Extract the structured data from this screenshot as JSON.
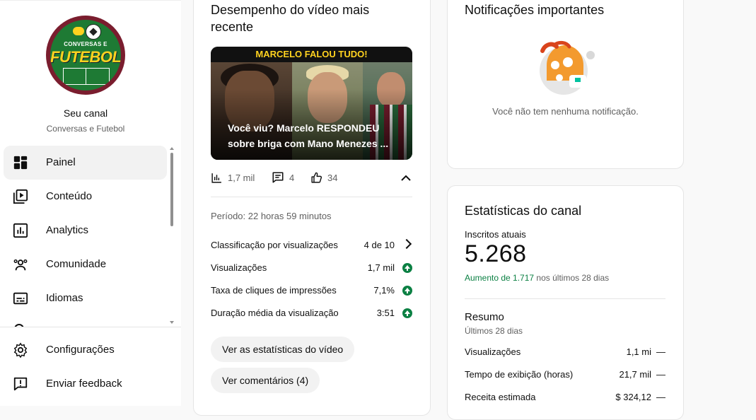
{
  "sidebar": {
    "logo": {
      "top_text": "CONVERSAS E",
      "big_text": "FUTEBOL"
    },
    "channel_label": "Seu canal",
    "channel_name": "Conversas e Futebol",
    "items": [
      {
        "label": "Painel",
        "icon": "dashboard-icon",
        "active": true
      },
      {
        "label": "Conteúdo",
        "icon": "content-icon"
      },
      {
        "label": "Analytics",
        "icon": "analytics-icon"
      },
      {
        "label": "Comunidade",
        "icon": "community-icon"
      },
      {
        "label": "Idiomas",
        "icon": "subtitles-icon"
      }
    ],
    "bottom_items": [
      {
        "label": "Configurações",
        "icon": "gear-icon"
      },
      {
        "label": "Enviar feedback",
        "icon": "feedback-icon"
      }
    ]
  },
  "latest_video": {
    "title": "Desempenho do vídeo mais recente",
    "thumbnail_banner": "MARCELO FALOU TUDO!",
    "video_title": "Você viu? Marcelo RESPONDEU sobre briga com Mano Menezes ...",
    "views": "1,7 mil",
    "comments": "4",
    "likes": "34",
    "period": "Período: 22 horas 59 minutos",
    "metrics": [
      {
        "label": "Classificação por visualizações",
        "value": "4 de 10"
      },
      {
        "label": "Visualizações",
        "value": "1,7 mil"
      },
      {
        "label": "Taxa de cliques de impressões",
        "value": "7,1%"
      },
      {
        "label": "Duração média da visualização",
        "value": "3:51"
      }
    ],
    "btn_stats": "Ver as estatísticas do vídeo",
    "btn_comments": "Ver comentários (4)"
  },
  "notifications": {
    "title": "Notificações importantes",
    "empty_text": "Você não tem nenhuma notificação."
  },
  "channel_stats": {
    "title": "Estatísticas do canal",
    "subs_label": "Inscritos atuais",
    "subs_value": "5.268",
    "growth_value": "Aumento de 1.717",
    "growth_rest": "nos últimos 28 dias",
    "summary_title": "Resumo",
    "summary_period": "Últimos 28 dias",
    "rows": [
      {
        "label": "Visualizações",
        "value": "1,1 mi",
        "trend": "—"
      },
      {
        "label": "Tempo de exibição (horas)",
        "value": "21,7 mil",
        "trend": "—"
      },
      {
        "label": "Receita estimada",
        "value": "$ 324,12",
        "trend": "—"
      }
    ]
  },
  "colors": {
    "accent_green": "#0b8043",
    "text_secondary": "#606060"
  }
}
